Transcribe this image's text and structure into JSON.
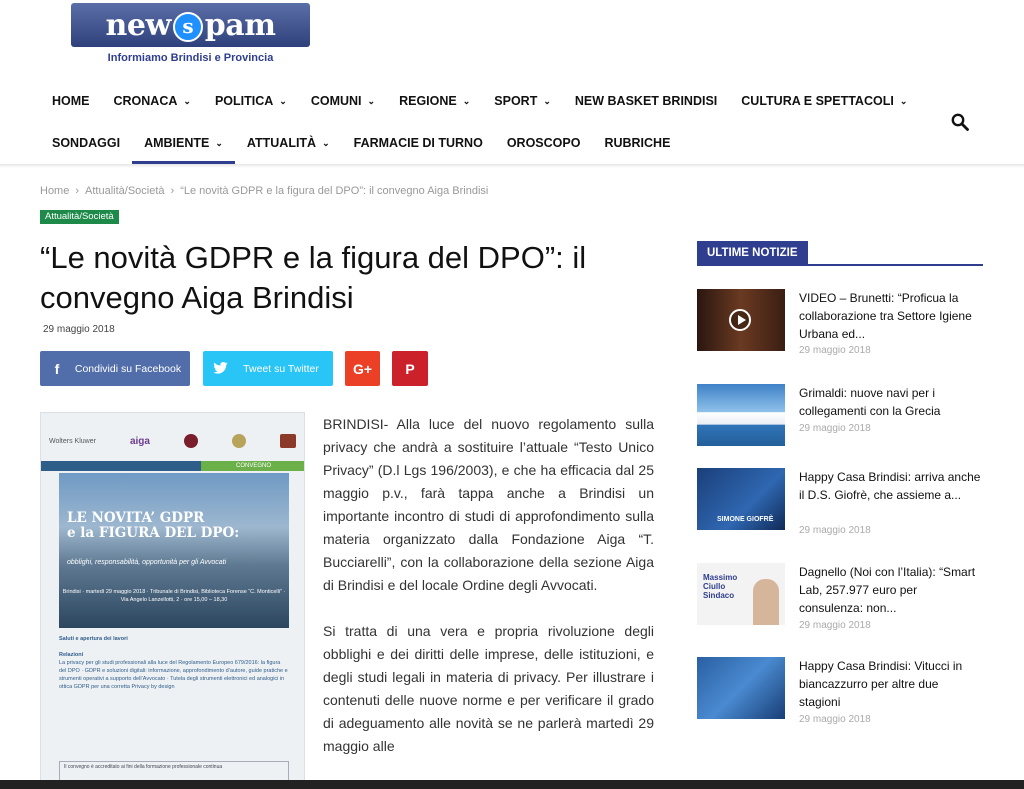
{
  "logo": {
    "text_left": "new",
    "badge": "s",
    "text_right": "pam",
    "subtitle": "Informiamo Brindisi e Provincia"
  },
  "nav": {
    "row1": [
      {
        "label": "HOME",
        "caret": false
      },
      {
        "label": "CRONACA",
        "caret": true
      },
      {
        "label": "POLITICA",
        "caret": true
      },
      {
        "label": "COMUNI",
        "caret": true
      },
      {
        "label": "REGIONE",
        "caret": true
      },
      {
        "label": "SPORT",
        "caret": true
      },
      {
        "label": "NEW BASKET BRINDISI",
        "caret": false
      },
      {
        "label": "CULTURA E SPETTACOLI",
        "caret": true
      }
    ],
    "row2": [
      {
        "label": "SONDAGGI",
        "caret": false
      },
      {
        "label": "AMBIENTE",
        "caret": true,
        "active": true
      },
      {
        "label": "ATTUALITÀ",
        "caret": true
      },
      {
        "label": "FARMACIE DI TURNO",
        "caret": false
      },
      {
        "label": "OROSCOPO",
        "caret": false
      },
      {
        "label": "RUBRICHE",
        "caret": false
      }
    ],
    "caret_glyph": "⌄"
  },
  "breadcrumb": {
    "home": "Home",
    "section": "Attualità/Società",
    "current": "“Le novità GDPR e la figura del DPO”: il convegno Aiga Brindisi",
    "sep": "›"
  },
  "article": {
    "category": "Attualità/Società",
    "title": "“Le novità GDPR e la figura del DPO”: il convegno Aiga Brindisi",
    "date": "29 maggio 2018",
    "share": {
      "facebook": "Condividi su Facebook",
      "twitter": "Tweet su Twitter",
      "gplus_icon": "G+",
      "pinterest_icon": "P"
    },
    "paragraphs": [
      "BRINDISI- Alla luce del nuovo regolamento sulla privacy che andrà a sostituire l’attuale “Testo Unico Privacy” (D.l Lgs 196/2003), e che ha efficacia dal 25 maggio p.v., farà tappa anche a Brindisi un importante incontro di studi di approfondimento sulla materia organizzato dalla Fondazione Aiga “T. Bucciarelli”, con la collaborazione della sezione Aiga di Brindisi e del locale Ordine degli Avvocati.",
      "Si tratta di una vera e propria rivoluzione degli obblighi e dei diritti delle imprese, delle istituzioni, e degli studi legali in materia di privacy. Per illustrare i contenuti delle nuove norme e per verificare il grado di adeguamento alle novità se ne parlerà martedì 29 maggio alle"
    ],
    "poster": {
      "logo1": "Wolters Kluwer",
      "logo2": "aiga",
      "band_label": "CONVEGNO",
      "headline1": "LE NOVITA’ GDPR",
      "headline2": "e la FIGURA DEL DPO:",
      "subline": "obblighi, responsabilità, opportunità per gli Avvocati",
      "venue": "Brindisi · martedì 29 maggio 2018 · Tribunale di Brindisi, Biblioteca Forense “C. Monticelli” · Via Angelo Lanzellotti, 2 · ore 15,00 – 18,30",
      "list_title1": "Saluti e apertura dei lavori",
      "list_title2": "Relazioni",
      "list_text": "La privacy per gli studi professionali alla luce del Regolamento Europeo 679/2016: la figura del DPO · GDPR e soluzioni digitali: informazione, approfondimento d’autore, guide pratiche e strumenti operativi a supporto dell’Avvocato · Tutela degli strumenti elettronici ed analogici in ottica GDPR per una corretta Privacy by design",
      "footer": "Il convegno è accreditato ai fini della formazione professionale continua"
    }
  },
  "sidebar": {
    "heading": "ULTIME NOTIZIE",
    "items": [
      {
        "title": "VIDEO – Brunetti: “Proficua la collaborazione tra Settore Igiene Urbana ed...",
        "date": "29 maggio 2018",
        "thumb": "video"
      },
      {
        "title": "Grimaldi: nuove navi per i collegamenti con la Grecia",
        "date": "29 maggio 2018",
        "thumb": "ship"
      },
      {
        "title": "Happy Casa Brindisi: arriva anche il D.S. Giofrè, che assieme a...",
        "date": "29 maggio 2018",
        "thumb": "basket",
        "thumb_label": "SIMONE GIOFRÈ"
      },
      {
        "title": "Dagnello (Noi con l’Italia): “Smart Lab, 257.977 euro per consulenza: non...",
        "date": "29 maggio 2018",
        "thumb": "poster",
        "thumb_label": "Massimo Ciullo Sindaco"
      },
      {
        "title": "Happy Casa Brindisi: Vitucci in biancazzurro per altre due stagioni",
        "date": "29 maggio 2018",
        "thumb": "basket2"
      }
    ]
  },
  "colors": {
    "brand": "#2f3e8e",
    "category": "#1e8a4a",
    "facebook": "#516eab",
    "twitter": "#29c5f6",
    "gplus": "#eb4026",
    "pinterest": "#ca212a"
  }
}
